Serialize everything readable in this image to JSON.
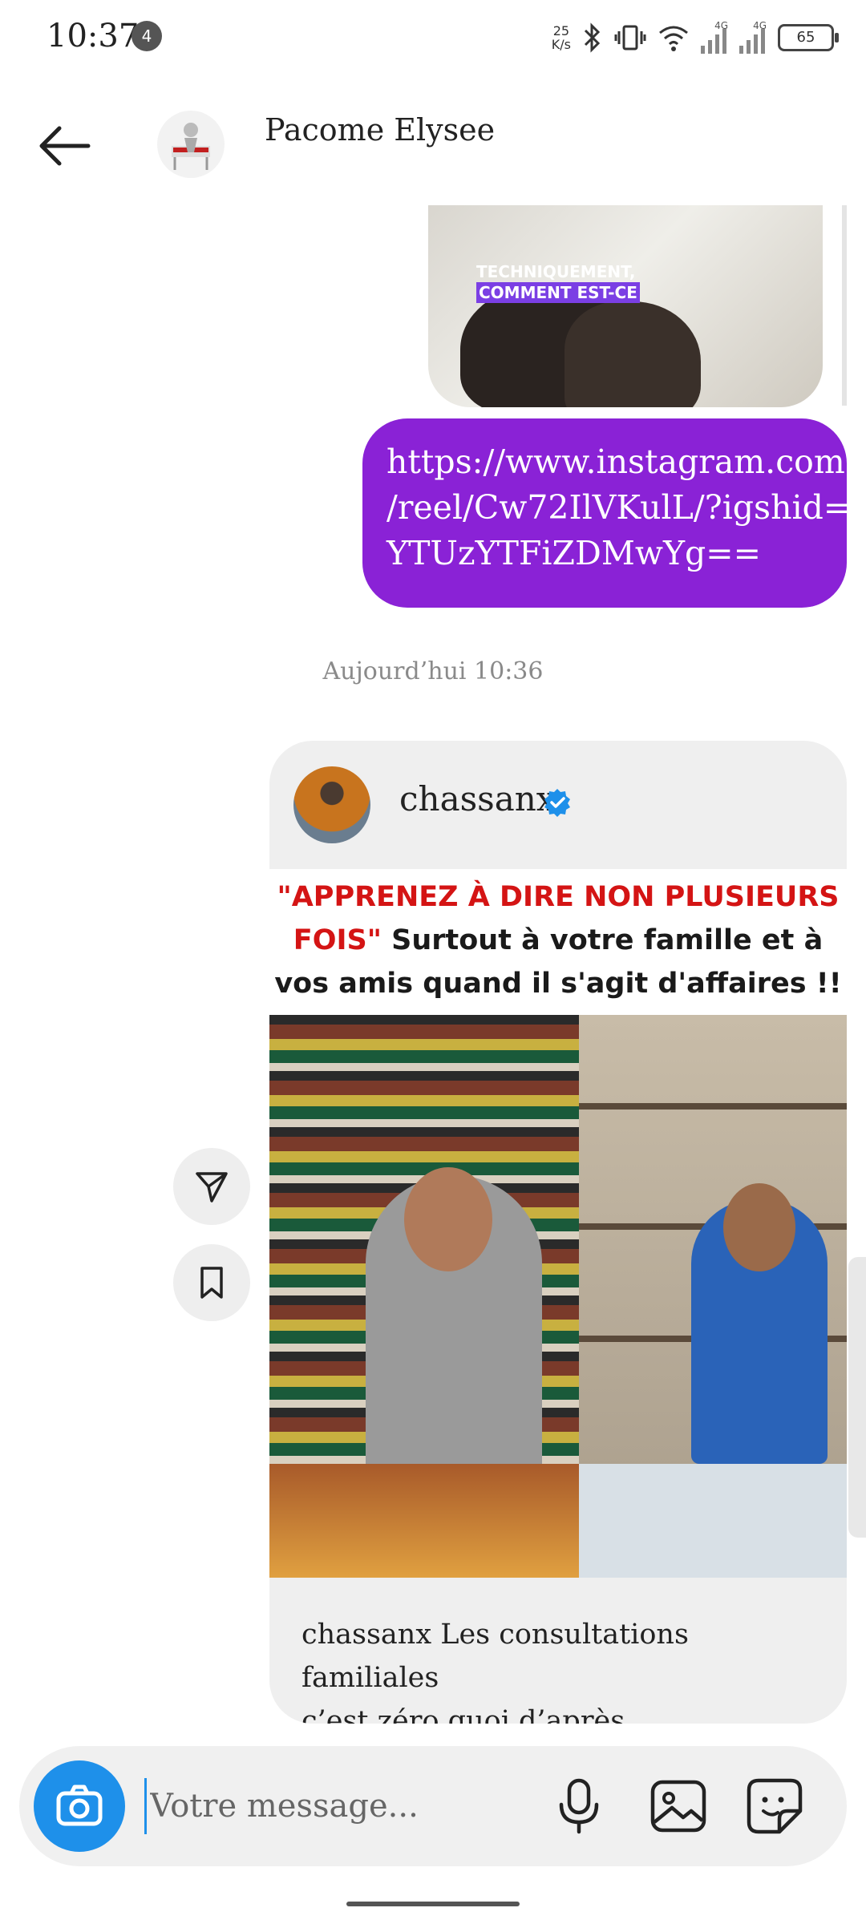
{
  "status_bar": {
    "time": "10:37",
    "notification_count": "4",
    "network_speed_top": "25",
    "network_speed_unit": "K/s",
    "signal_1_label": "4G",
    "signal_2_label": "4G",
    "battery": "65"
  },
  "header": {
    "contact_name": "Pacome Elysee",
    "icons": [
      "back-arrow-icon",
      "contact-avatar"
    ]
  },
  "messages": {
    "video_thumb_caption_line1": "TECHNIQUEMENT,",
    "video_thumb_caption_line2": "COMMENT EST-CE",
    "link_lines": [
      "https://www.instagram.com",
      "/reel/Cw72IlVKulL/?igshid=",
      "YTUzYTFiZDMwYg=="
    ],
    "date_separator": "Aujourd’hui 10:36",
    "shared_post": {
      "username": "chassanx",
      "verified": true,
      "headline_red": "\"APPRENEZ À DIRE NON PLUSIEURS FOIS\"",
      "headline_black": " Surtout à votre famille et à vos amis quand il s'agit d'affaires !!",
      "caption_line1": "chassanx Les consultations familiales",
      "caption_line2": "c’est zéro quoi d’après souleymane.bf..."
    },
    "side_actions": [
      "send-icon",
      "bookmark-icon"
    ]
  },
  "composer": {
    "placeholder": "Votre message...",
    "icons": [
      "camera-icon",
      "microphone-icon",
      "gallery-icon",
      "sticker-icon"
    ]
  },
  "colors": {
    "link_bubble": "#8a22d6",
    "camera_button": "#1e90ea",
    "headline_red": "#d41414",
    "verified_badge": "#1e90ea"
  }
}
